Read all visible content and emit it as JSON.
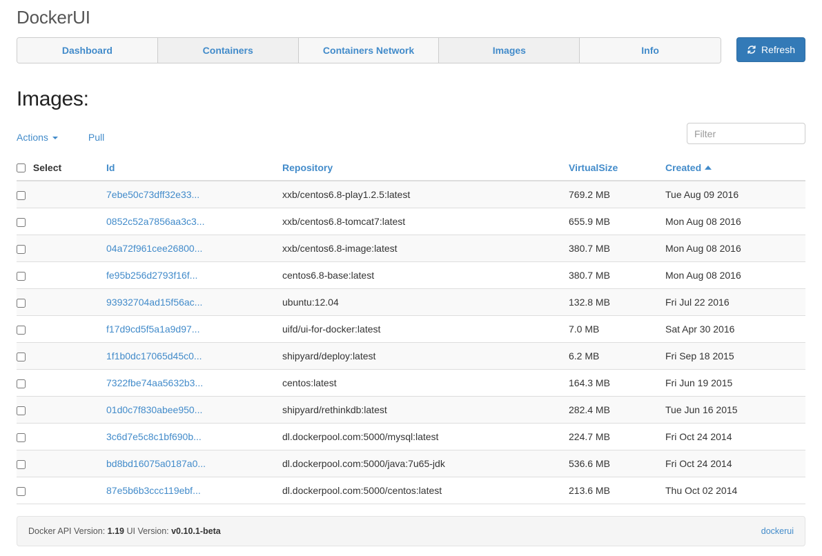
{
  "brand": "DockerUI",
  "nav": {
    "tabs": [
      {
        "label": "Dashboard"
      },
      {
        "label": "Containers"
      },
      {
        "label": "Containers Network"
      },
      {
        "label": "Images"
      },
      {
        "label": "Info"
      }
    ],
    "refresh_label": "Refresh",
    "refresh_icon": "refresh-icon",
    "refresh_color": "#337ab7"
  },
  "page": {
    "title": "Images:"
  },
  "toolbar": {
    "actions_label": "Actions",
    "actions_caret_icon": "caret-down-icon",
    "pull_label": "Pull",
    "filter_placeholder": "Filter",
    "filter_value": ""
  },
  "table": {
    "select_label": "Select",
    "columns": [
      {
        "key": "id",
        "label": "Id",
        "sorted": false
      },
      {
        "key": "repository",
        "label": "Repository",
        "sorted": false
      },
      {
        "key": "virtualsize",
        "label": "VirtualSize",
        "sorted": false
      },
      {
        "key": "created",
        "label": "Created",
        "sorted": true,
        "sort_dir": "asc",
        "sort_icon": "caret-up-icon"
      }
    ],
    "rows": [
      {
        "id": "7ebe50c73dff32e33...",
        "repository": "xxb/centos6.8-play1.2.5:latest",
        "virtualsize": "769.2 MB",
        "created": "Tue Aug 09 2016",
        "checked": false
      },
      {
        "id": "0852c52a7856aa3c3...",
        "repository": "xxb/centos6.8-tomcat7:latest",
        "virtualsize": "655.9 MB",
        "created": "Mon Aug 08 2016",
        "checked": false
      },
      {
        "id": "04a72f961cee26800...",
        "repository": "xxb/centos6.8-image:latest",
        "virtualsize": "380.7 MB",
        "created": "Mon Aug 08 2016",
        "checked": false
      },
      {
        "id": "fe95b256d2793f16f...",
        "repository": "centos6.8-base:latest",
        "virtualsize": "380.7 MB",
        "created": "Mon Aug 08 2016",
        "checked": false
      },
      {
        "id": "93932704ad15f56ac...",
        "repository": "ubuntu:12.04",
        "virtualsize": "132.8 MB",
        "created": "Fri Jul 22 2016",
        "checked": false
      },
      {
        "id": "f17d9cd5f5a1a9d97...",
        "repository": "uifd/ui-for-docker:latest",
        "virtualsize": "7.0 MB",
        "created": "Sat Apr 30 2016",
        "checked": false
      },
      {
        "id": "1f1b0dc17065d45c0...",
        "repository": "shipyard/deploy:latest",
        "virtualsize": "6.2 MB",
        "created": "Fri Sep 18 2015",
        "checked": false
      },
      {
        "id": "7322fbe74aa5632b3...",
        "repository": "centos:latest",
        "virtualsize": "164.3 MB",
        "created": "Fri Jun 19 2015",
        "checked": false
      },
      {
        "id": "01d0c7f830abee950...",
        "repository": "shipyard/rethinkdb:latest",
        "virtualsize": "282.4 MB",
        "created": "Tue Jun 16 2015",
        "checked": false
      },
      {
        "id": "3c6d7e5c8c1bf690b...",
        "repository": "dl.dockerpool.com:5000/mysql:latest",
        "virtualsize": "224.7 MB",
        "created": "Fri Oct 24 2014",
        "checked": false
      },
      {
        "id": "bd8bd16075a0187a0...",
        "repository": "dl.dockerpool.com:5000/java:7u65-jdk",
        "virtualsize": "536.6 MB",
        "created": "Fri Oct 24 2014",
        "checked": false
      },
      {
        "id": "87e5b6b3ccc119ebf...",
        "repository": "dl.dockerpool.com:5000/centos:latest",
        "virtualsize": "213.6 MB",
        "created": "Thu Oct 02 2014",
        "checked": false
      }
    ]
  },
  "footer": {
    "api_version_label": "Docker API Version:",
    "api_version_value": "1.19",
    "ui_version_label": "UI Version:",
    "ui_version_value": "v0.10.1-beta",
    "link_label": "dockerui"
  }
}
